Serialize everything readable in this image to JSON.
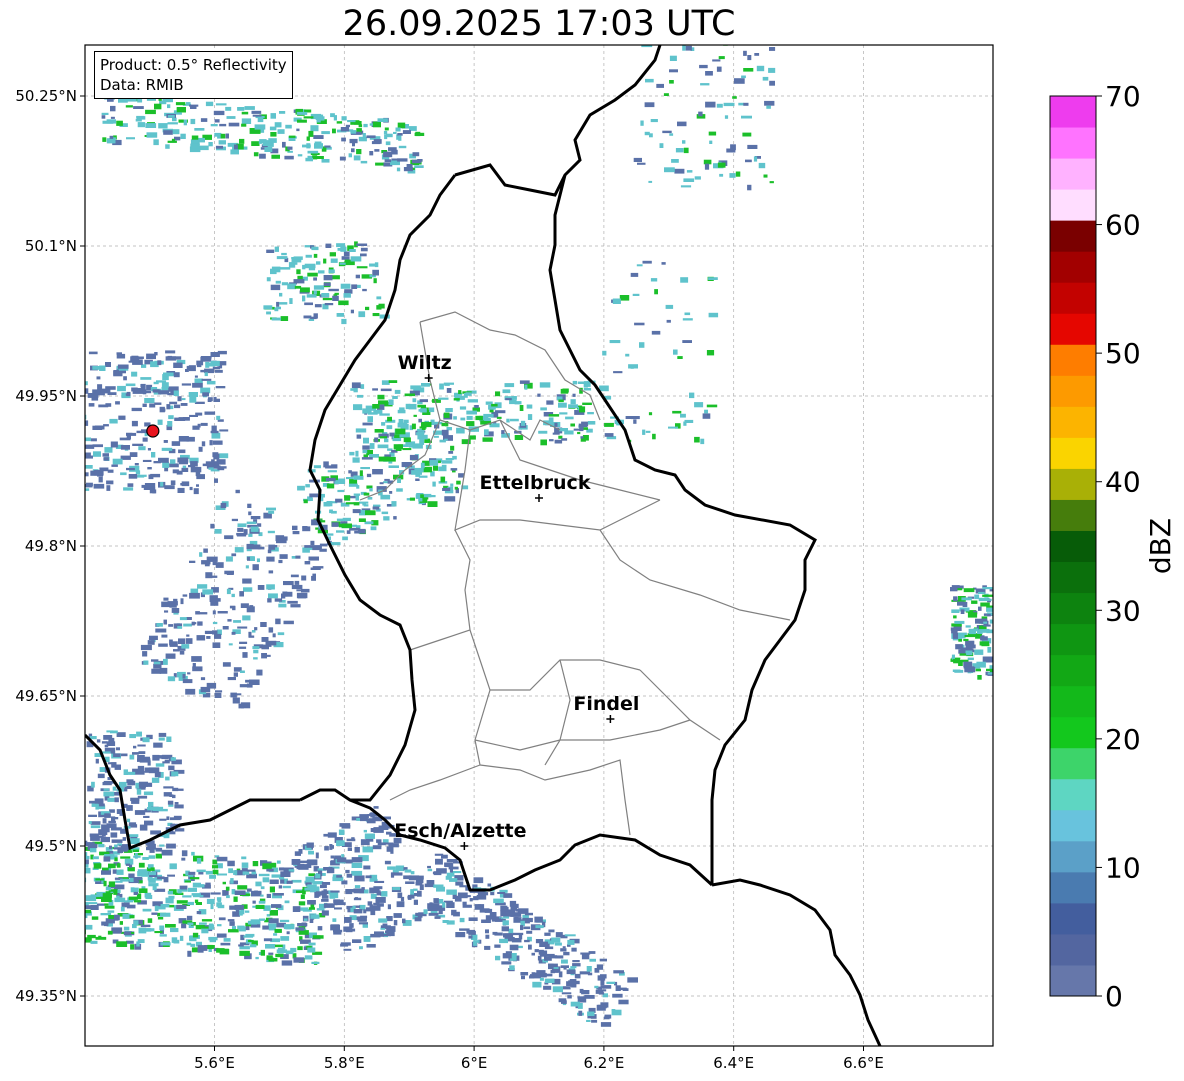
{
  "title": "26.09.2025 17:03 UTC",
  "info": {
    "product": "Product: 0.5° Reflectivity",
    "data": "Data: RMIB"
  },
  "lon_ticks": [
    {
      "value": 5.6,
      "label": "5.6°E"
    },
    {
      "value": 5.8,
      "label": "5.8°E"
    },
    {
      "value": 6.0,
      "label": "6°E"
    },
    {
      "value": 6.2,
      "label": "6.2°E"
    },
    {
      "value": 6.4,
      "label": "6.4°E"
    },
    {
      "value": 6.6,
      "label": "6.6°E"
    }
  ],
  "lat_ticks": [
    {
      "value": 50.25,
      "label": "50.25°N"
    },
    {
      "value": 50.1,
      "label": "50.1°N"
    },
    {
      "value": 49.95,
      "label": "49.95°N"
    },
    {
      "value": 49.8,
      "label": "49.8°N"
    },
    {
      "value": 49.65,
      "label": "49.65°N"
    },
    {
      "value": 49.5,
      "label": "49.5°N"
    },
    {
      "value": 49.35,
      "label": "49.35°N"
    }
  ],
  "cities": [
    {
      "name": "Wiltz",
      "lon": 5.93,
      "lat": 49.968
    },
    {
      "name": "Ettelbruck",
      "lon": 6.1,
      "lat": 49.848
    },
    {
      "name": "Findel",
      "lon": 6.21,
      "lat": 49.627
    },
    {
      "name": "Esch/Alzette",
      "lon": 5.985,
      "lat": 49.5
    }
  ],
  "radar_site": {
    "lon": 5.505,
    "lat": 49.915,
    "color": "#e8141e"
  },
  "colorbar": {
    "label": "dBZ",
    "min": 0,
    "max": 70,
    "ticks": [
      "0",
      "10",
      "20",
      "30",
      "40",
      "50",
      "60",
      "70"
    ],
    "colors": [
      "#6677aa",
      "#5366a0",
      "#435e9e",
      "#4a7bb0",
      "#5ba0c8",
      "#68c3dd",
      "#5ed6c2",
      "#3dd46a",
      "#13c81d",
      "#13b91a",
      "#12a815",
      "#0f9612",
      "#0d830f",
      "#0b700c",
      "#075c08",
      "#467d0c",
      "#a9b006",
      "#fad400",
      "#fcb400",
      "#fd9a00",
      "#fe7d00",
      "#e50600",
      "#c30200",
      "#a20000",
      "#7a0000",
      "#ffddff",
      "#ffb2ff",
      "#ff73ff",
      "#ee3cee"
    ]
  },
  "colors": {
    "border": "#000000",
    "canton_lines": "#808080",
    "grid": "#b0b0b0",
    "echo_weak": "#5a71a8",
    "echo_mid": "#5fc3cc",
    "echo_strong": "#1bbf2a"
  }
}
